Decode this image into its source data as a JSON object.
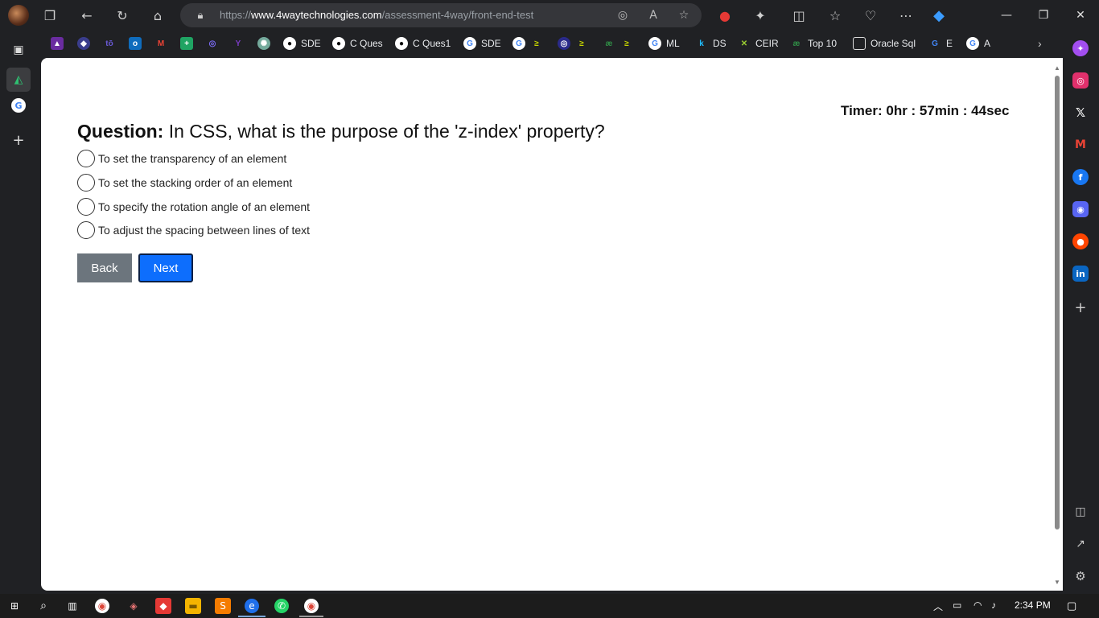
{
  "browser": {
    "url_prefix": "https://",
    "url_host": "www.4waytechnologies.com",
    "url_path": "/assessment-4way/front-end-test",
    "bookmarks": [
      "SDE",
      "C Ques",
      "C Ques1",
      "SDE",
      "ML",
      "DS",
      "CEIR",
      "Top 10",
      "Oracle Sql",
      "E",
      "A"
    ]
  },
  "quiz": {
    "timer": "Timer: 0hr : 57min : 44sec",
    "question_label": "Question:",
    "question_text": " In CSS, what is the purpose of the 'z-index' property?",
    "options": [
      "To set the transparency of an element",
      "To set the stacking order of an element",
      "To specify the rotation angle of an element",
      "To adjust the spacing between lines of text"
    ],
    "back_label": "Back",
    "next_label": "Next"
  },
  "taskbar": {
    "clock": "2:34 PM"
  },
  "colors": {
    "next_button": "#0d6efd",
    "back_button": "#6c757d",
    "chrome_bg": "#202124"
  }
}
